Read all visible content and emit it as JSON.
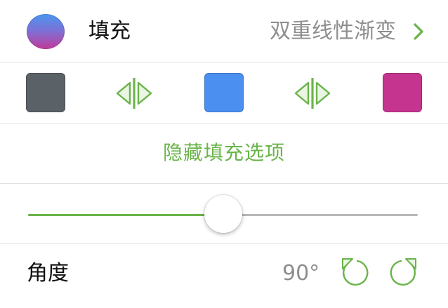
{
  "fill": {
    "label": "填充",
    "value": "双重线性渐变",
    "swatch_colors": [
      "#4b97f0",
      "#7a72d8",
      "#c13a98"
    ]
  },
  "gradient_stops": {
    "colors": [
      "#5a6167",
      "#4b90f0",
      "#c5348e"
    ]
  },
  "hide_fill_options_label": "隐藏填充选项",
  "slider": {
    "level": 0.5
  },
  "angle": {
    "label": "角度",
    "value": "90°"
  },
  "colors": {
    "accent": "#6ab44a",
    "secondary_text": "#8e8e8e",
    "separator": "#e2e2e2"
  },
  "icons": {
    "chevron": "chevron-right-icon",
    "swap": "swap-stops-icon",
    "rotate_ccw": "rotate-counterclockwise-icon",
    "rotate_cw": "rotate-clockwise-icon"
  }
}
